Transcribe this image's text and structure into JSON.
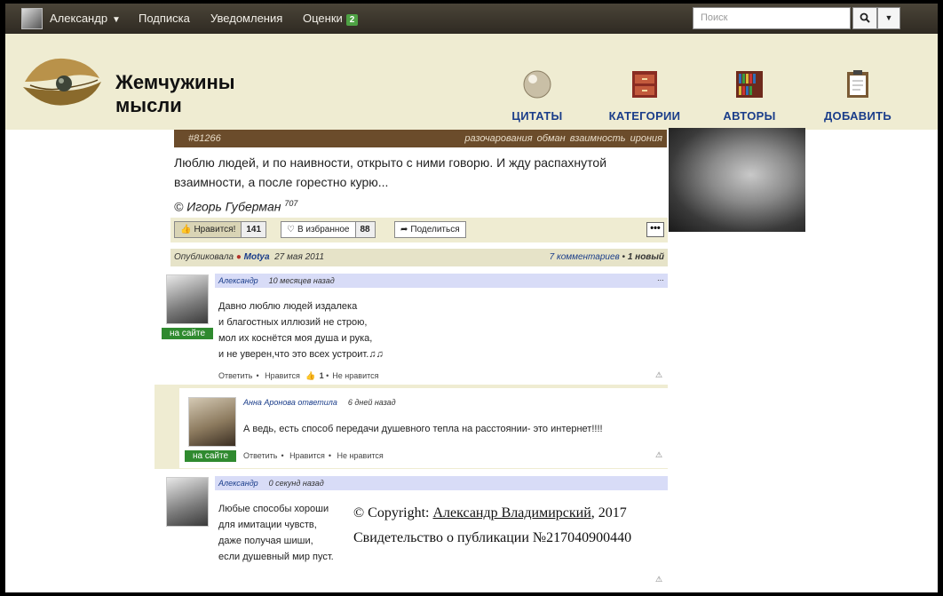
{
  "topnav": {
    "user": "Александр",
    "subscription": "Подписка",
    "notifications": "Уведомления",
    "ratings": "Оценки",
    "ratings_count": "2",
    "search_placeholder": "Поиск"
  },
  "header": {
    "title_line1": "Жемчужины",
    "title_line2": "мысли",
    "nav": [
      "ЦИТАТЫ",
      "КАТЕГОРИИ",
      "АВТОРЫ",
      "ДОБАВИТЬ"
    ]
  },
  "quote": {
    "id": "#81266",
    "tags": [
      "разочарования",
      "обман",
      "взаимность",
      "ирония"
    ],
    "text": "Люблю людей, и по наивности, открыто с ними говорю. И жду распахнутой взаимности, а после горестно курю...",
    "author": "© Игорь Губерман",
    "author_count": "707",
    "like_label": "Нравится!",
    "like_count": "141",
    "fav_label": "В избранное",
    "fav_count": "88",
    "share_label": "Поделиться",
    "more": "•••"
  },
  "published": {
    "label": "Опубликовала",
    "user": "Motya",
    "date": "27 мая 2011",
    "comments": "7 комментариев",
    "new_sep": "•",
    "new": "1 новый"
  },
  "comments": [
    {
      "author": "Александр",
      "time": "10 месяцев назад",
      "menu": "...",
      "lines": [
        "Давно люблю людей издалека",
        "и благостных иллюзий не строю,",
        "мол их коснётся моя душа и рука,",
        "и не уверен,что это всех устроит.♫♫"
      ],
      "online": "на сайте",
      "reply": "Ответить",
      "like": "Нравится",
      "like_count": "1",
      "dislike": "Не нравится"
    },
    {
      "author": "Анна Аронова ответила",
      "time": "6 дней назад",
      "lines": [
        "А ведь, есть способ передачи душевного тепла на расстоянии- это интернет!!!!"
      ],
      "online": "на сайте",
      "reply": "Ответить",
      "like": "Нравится",
      "dislike": "Не нравится"
    },
    {
      "author": "Александр",
      "time": "0 секунд назад",
      "lines": [
        "Любые способы хороши",
        "для имитации чувств,",
        "даже получая шиши,",
        "если душевный мир пуст."
      ]
    }
  ],
  "copyright": {
    "prefix": "© Copyright: ",
    "name": "Александр Владимирский",
    "year": ", 2017",
    "certificate": "Свидетельство о публикации №217040900440"
  }
}
